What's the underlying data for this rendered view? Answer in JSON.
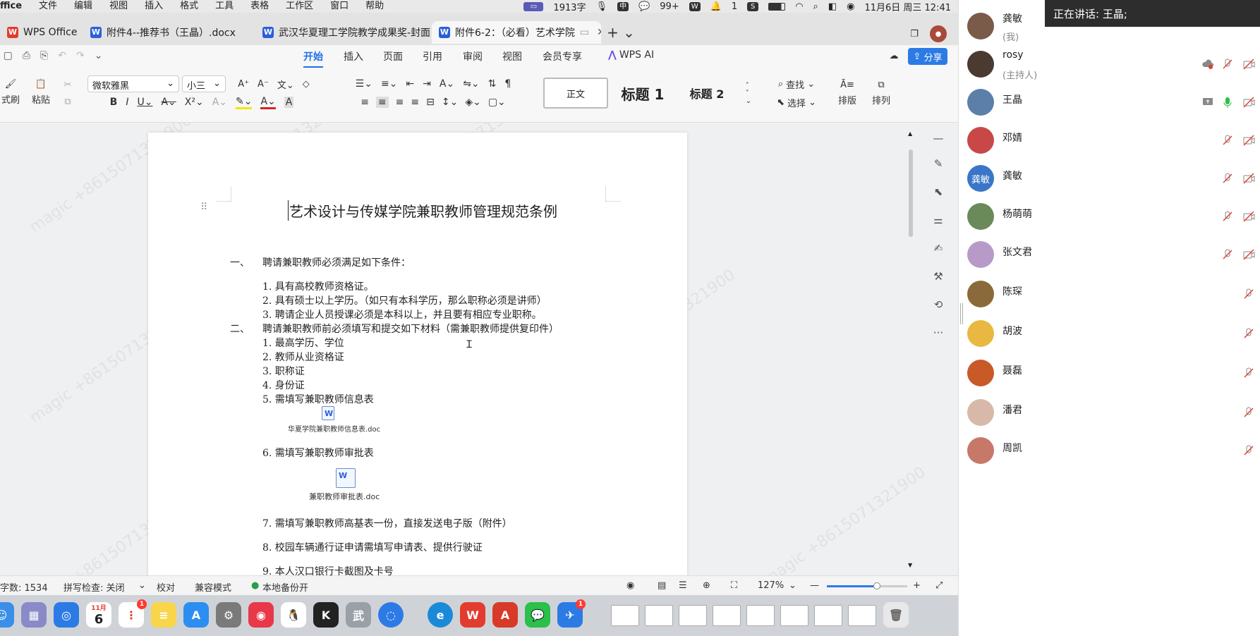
{
  "menubar": {
    "app": "ffice",
    "items": [
      "文件",
      "编辑",
      "视图",
      "插入",
      "格式",
      "工具",
      "表格",
      "工作区",
      "窗口",
      "帮助"
    ],
    "word_count_short": "1913字",
    "notif_count": "99+",
    "wechat_count": "1",
    "datetime": "11月6日 周三  12:41"
  },
  "tabs": [
    {
      "label": "WPS Office",
      "active": false
    },
    {
      "label": "附件4--推荐书（王晶）.docx",
      "active": false
    },
    {
      "label": "武汉华夏理工学院教学成果奖-封面",
      "active": false
    },
    {
      "label": "附件6-2：（必看）艺术学院",
      "active": true
    }
  ],
  "ribbon": {
    "tabs": [
      "开始",
      "插入",
      "页面",
      "引用",
      "审阅",
      "视图",
      "会员专享"
    ],
    "ai_label": "WPS AI",
    "share_label": "分享",
    "format_painter": "式刷",
    "paste": "粘贴",
    "font_name": "微软雅黑",
    "font_size": "小三",
    "styles": [
      "正文",
      "标题 1",
      "标题 2"
    ],
    "find": "查找",
    "select": "选择",
    "layout": "排版",
    "arrange": "排列"
  },
  "document": {
    "title": "艺术设计与传媒学院兼职教师管理规范条例",
    "section1_num": "一、",
    "section1": "聘请兼职教师必须满足如下条件：",
    "s1_items": [
      "1.  具有高校教师资格证。",
      "2.  具有硕士以上学历。（如只有本科学历，那么职称必须是讲师）",
      "3.  聘请企业人员授课必须是本科以上，并且要有相应专业职称。"
    ],
    "section2_num": "二、",
    "section2": "聘请兼职教师前必须填写和提交如下材料（需兼职教师提供复印件）",
    "s2_items": [
      "1.  最高学历、学位",
      "2.  教师从业资格证",
      "3.  职称证",
      "4.  身份证",
      "5.  需填写兼职教师信息表"
    ],
    "attachment1": "华夏学院兼职教师信息表.doc",
    "item6": "6.  需填写兼职教师审批表",
    "attachment2": "兼职教师审批表.doc",
    "item7": "7.  需填写兼职教师高基表一份，直接发送电子版（附件）",
    "item8": "8.  校园车辆通行证申请需填写申请表、提供行驶证",
    "item9": "9.  本人汉口银行卡截图及卡号",
    "watermark": "magic +8615071321900"
  },
  "statusbar": {
    "word_count": "字数: 1534",
    "spell_check": "拼写检查: 关闭",
    "proofread": "校对",
    "compat": "兼容模式",
    "backup": "本地备份开",
    "zoom": "127%"
  },
  "dock": {
    "calendar_month": "11月",
    "calendar_day": "6",
    "reminders_badge": "1",
    "feishu_badge": "1",
    "wu_label": "武"
  },
  "meeting": {
    "speaking": "正在讲话:  王晶;",
    "participants": [
      {
        "name": "龚敏",
        "role": "(我)",
        "avatar": "photo",
        "color": "#7a5a48"
      },
      {
        "name": "rosy",
        "role": "(主持人)",
        "avatar": "photo",
        "color": "#4a3a30"
      },
      {
        "name": "王晶",
        "role": "",
        "avatar": "photo",
        "color": "#5b7fa8"
      },
      {
        "name": "邓婧",
        "role": "",
        "avatar": "photo",
        "color": "#c84848"
      },
      {
        "name": "龚敏",
        "role": "",
        "avatar": "text",
        "color": "#3a76c8"
      },
      {
        "name": "杨萌萌",
        "role": "",
        "avatar": "photo",
        "color": "#6a8a5a"
      },
      {
        "name": "张文君",
        "role": "",
        "avatar": "photo",
        "color": "#b89ac8"
      },
      {
        "name": "陈琛",
        "role": "",
        "avatar": "photo",
        "color": "#8a6a3a"
      },
      {
        "name": "胡波",
        "role": "",
        "avatar": "photo",
        "color": "#e8b840"
      },
      {
        "name": "聂磊",
        "role": "",
        "avatar": "photo",
        "color": "#c85a28"
      },
      {
        "name": "潘君",
        "role": "",
        "avatar": "photo",
        "color": "#d8b8a8"
      },
      {
        "name": "周凯",
        "role": "",
        "avatar": "photo",
        "color": "#c87868"
      }
    ]
  }
}
